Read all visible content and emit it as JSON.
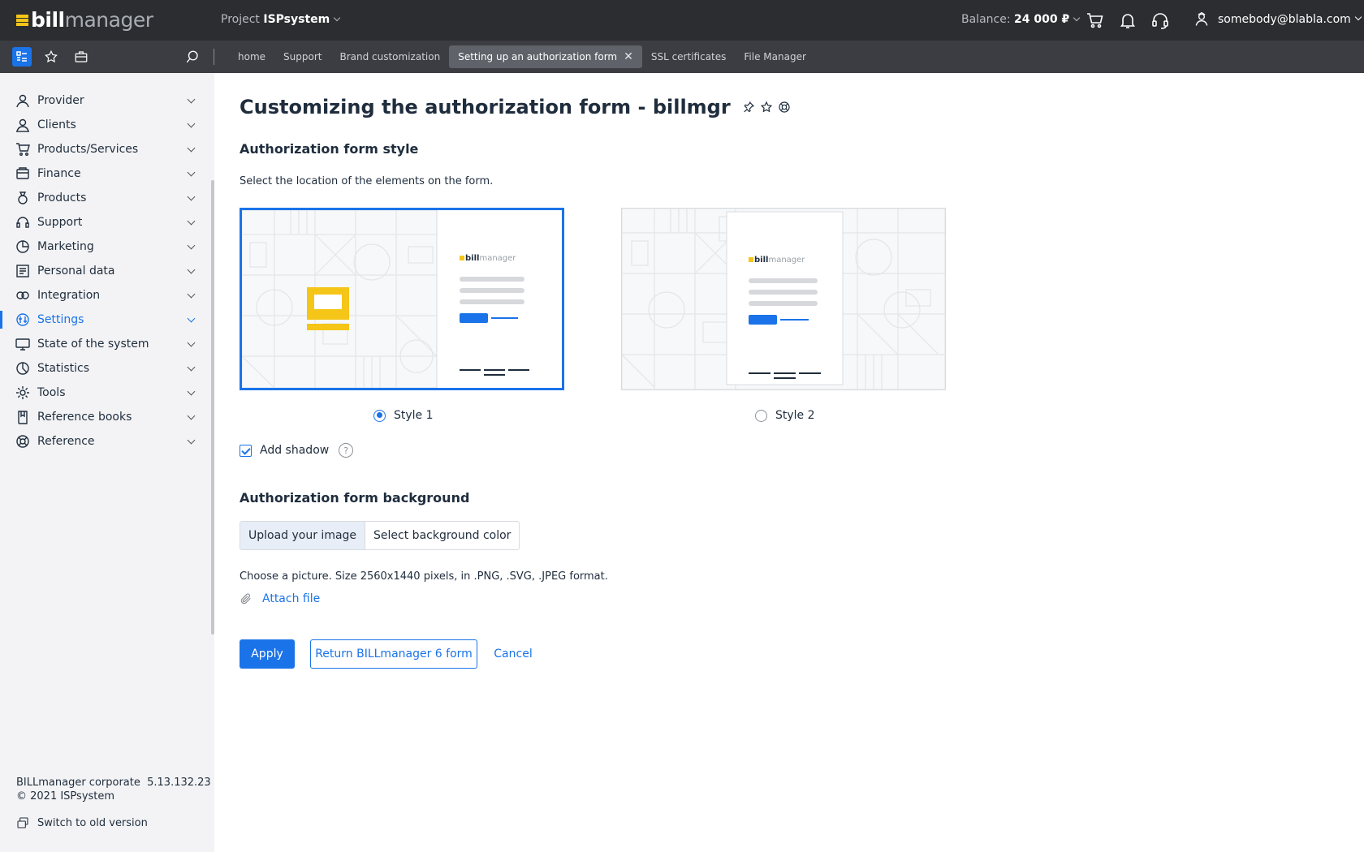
{
  "header": {
    "logo_bill": "bill",
    "logo_manager": "manager",
    "project_label": "Project",
    "project_name": "ISPsystem",
    "balance_label": "Balance:",
    "balance_value": "24 000 ₽",
    "user_email": "somebody@blabla.com"
  },
  "tabs": [
    {
      "label": "home"
    },
    {
      "label": "Support"
    },
    {
      "label": "Brand customization"
    },
    {
      "label": "Setting up an authorization form",
      "active": true
    },
    {
      "label": "SSL certificates"
    },
    {
      "label": "File Manager"
    }
  ],
  "tab_close": "✕",
  "sidebar": {
    "items": [
      {
        "label": "Provider",
        "icon": "provider-icon"
      },
      {
        "label": "Clients",
        "icon": "clients-icon"
      },
      {
        "label": "Products/Services",
        "icon": "cart-icon"
      },
      {
        "label": "Finance",
        "icon": "finance-icon"
      },
      {
        "label": "Products",
        "icon": "products-icon"
      },
      {
        "label": "Support",
        "icon": "support-icon"
      },
      {
        "label": "Marketing",
        "icon": "marketing-icon"
      },
      {
        "label": "Personal data",
        "icon": "personal-data-icon"
      },
      {
        "label": "Integration",
        "icon": "integration-icon"
      },
      {
        "label": "Settings",
        "icon": "settings-icon",
        "active": true
      },
      {
        "label": "State of the system",
        "icon": "monitor-icon"
      },
      {
        "label": "Statistics",
        "icon": "statistics-icon"
      },
      {
        "label": "Tools",
        "icon": "gear-icon"
      },
      {
        "label": "Reference books",
        "icon": "book-icon"
      },
      {
        "label": "Reference",
        "icon": "lifebuoy-icon"
      }
    ],
    "version_name": "BILLmanager corporate",
    "version_number": "5.13.132.23",
    "copyright": "© 2021 ISPsystem",
    "switch_label": "Switch to old version"
  },
  "main": {
    "title": "Customizing the authorization form - billmgr",
    "style_heading": "Authorization form style",
    "style_desc": "Select the location of the elements on the form.",
    "style1_label": "Style 1",
    "style2_label": "Style 2",
    "preview_logo_bill": "bill",
    "preview_logo_manager": "manager",
    "shadow_label": "Add shadow",
    "help_glyph": "?",
    "bg_heading": "Authorization form background",
    "seg_upload": "Upload your image",
    "seg_color": "Select background color",
    "picture_desc": "Choose a picture. Size 2560x1440 pixels, in .PNG, .SVG, .JPEG format.",
    "attach_label": "Attach file",
    "apply_label": "Apply",
    "return_label": "Return BILLmanager 6 form",
    "cancel_label": "Cancel"
  },
  "colors": {
    "accent": "#1a73e8",
    "topbar": "#2b2d31",
    "tabbar": "#3b3d42",
    "brand_yellow": "#f5c518"
  }
}
